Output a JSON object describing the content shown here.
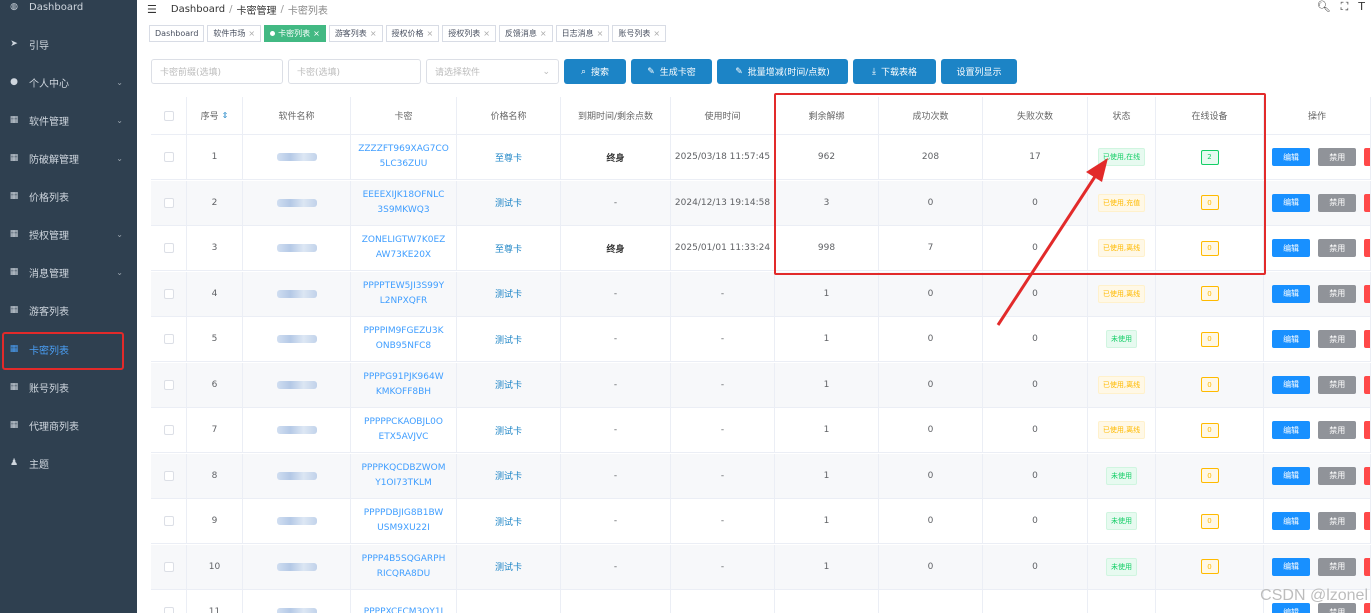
{
  "sidebar": {
    "items": [
      {
        "label": "Dashboard",
        "icon": "dashboard-icon",
        "glyph": "◍",
        "arrow": false
      },
      {
        "label": "引导",
        "icon": "send-icon",
        "glyph": "➤",
        "arrow": false
      },
      {
        "label": "个人中心",
        "icon": "user-icon",
        "glyph": "●",
        "arrow": true
      },
      {
        "label": "软件管理",
        "icon": "grid-icon",
        "glyph": "▦",
        "arrow": true
      },
      {
        "label": "防破解管理",
        "icon": "grid-icon",
        "glyph": "▦",
        "arrow": true
      },
      {
        "label": "价格列表",
        "icon": "grid-icon",
        "glyph": "▦",
        "arrow": false
      },
      {
        "label": "授权管理",
        "icon": "grid-icon",
        "glyph": "▦",
        "arrow": true
      },
      {
        "label": "消息管理",
        "icon": "grid-icon",
        "glyph": "▦",
        "arrow": true
      },
      {
        "label": "游客列表",
        "icon": "grid-icon",
        "glyph": "▦",
        "arrow": false
      },
      {
        "label": "卡密列表",
        "icon": "grid-icon",
        "glyph": "▦",
        "arrow": false,
        "active": true
      },
      {
        "label": "账号列表",
        "icon": "grid-icon",
        "glyph": "▦",
        "arrow": false
      },
      {
        "label": "代理商列表",
        "icon": "grid-icon",
        "glyph": "▦",
        "arrow": false
      },
      {
        "label": "主题",
        "icon": "shirt-icon",
        "glyph": "♟",
        "arrow": false
      }
    ]
  },
  "topbar": {
    "breadcrumb": [
      "Dashboard",
      "卡密管理",
      "卡密列表"
    ],
    "sep": "/",
    "icons": [
      "search-icon",
      "fullscreen-icon",
      "font-size-icon"
    ]
  },
  "tags": [
    {
      "label": "Dashboard",
      "closable": false
    },
    {
      "label": "软件市场",
      "closable": true
    },
    {
      "label": "卡密列表",
      "closable": true,
      "active": true
    },
    {
      "label": "游客列表",
      "closable": true
    },
    {
      "label": "授权价格",
      "closable": true
    },
    {
      "label": "授权列表",
      "closable": true
    },
    {
      "label": "反馈消息",
      "closable": true
    },
    {
      "label": "日志消息",
      "closable": true
    },
    {
      "label": "账号列表",
      "closable": true
    }
  ],
  "filters": {
    "prefix_placeholder": "卡密前缀(选填)",
    "card_placeholder": "卡密(选填)",
    "software_placeholder": "请选择软件",
    "buttons": {
      "search": "搜索",
      "generate": "生成卡密",
      "batch": "批量增减(时间/点数)",
      "download": "下载表格",
      "columns": "设置列显示"
    }
  },
  "table": {
    "headers": [
      "",
      "序号",
      "软件名称",
      "卡密",
      "价格名称",
      "到期时间/剩余点数",
      "使用时间",
      "剩余解绑",
      "成功次数",
      "失败次数",
      "状态",
      "在线设备",
      "操作"
    ],
    "actions": {
      "edit": "编辑",
      "ban": "禁用"
    },
    "rows": [
      {
        "no": "1",
        "software_suffix": "",
        "card": [
          "ZZZZFT969XAG7CO",
          "5LC36ZUU"
        ],
        "price": "至尊卡",
        "expire": "终身",
        "used": "2025/03/18 11:57:45",
        "unbind": "962",
        "success": "208",
        "fail": "17",
        "status": "已使用,在线",
        "status_color": "green",
        "online": "2"
      },
      {
        "no": "2",
        "software_suffix": "",
        "card": [
          "EEEEXIJK18OFNLC",
          "3S9MKWQ3"
        ],
        "price": "测试卡",
        "expire": "-",
        "used": "2024/12/13 19:14:58",
        "unbind": "3",
        "success": "0",
        "fail": "0",
        "status": "已使用,充值",
        "status_color": "orange",
        "online": "0"
      },
      {
        "no": "3",
        "software_suffix": "",
        "card": [
          "ZONELIGTW7K0EZ",
          "AW73KE20X"
        ],
        "price": "至尊卡",
        "expire": "终身",
        "used": "2025/01/01 11:33:24",
        "unbind": "998",
        "success": "7",
        "fail": "0",
        "status": "已使用,离线",
        "status_color": "orange",
        "online": "0"
      },
      {
        "no": "4",
        "software_suffix": "",
        "card": [
          "PPPPTEW5JI3S99Y",
          "L2NPXQFR"
        ],
        "price": "测试卡",
        "expire": "-",
        "used": "-",
        "unbind": "1",
        "success": "0",
        "fail": "0",
        "status": "已使用,离线",
        "status_color": "orange",
        "online": "0"
      },
      {
        "no": "5",
        "software_suffix": "",
        "card": [
          "PPPPIM9FGEZU3K",
          "ONB95NFC8"
        ],
        "price": "测试卡",
        "expire": "-",
        "used": "-",
        "unbind": "1",
        "success": "0",
        "fail": "0",
        "status": "未使用",
        "status_color": "green",
        "online": "0"
      },
      {
        "no": "6",
        "software_suffix": "",
        "card": [
          "PPPPG91PJK964W",
          "KMKOFF8BH"
        ],
        "price": "测试卡",
        "expire": "-",
        "used": "-",
        "unbind": "1",
        "success": "0",
        "fail": "0",
        "status": "已使用,离线",
        "status_color": "orange",
        "online": "0"
      },
      {
        "no": "7",
        "software_suffix": "",
        "card": [
          "PPPPPCKAOBJL0O",
          "ETX5AVJVC"
        ],
        "price": "测试卡",
        "expire": "-",
        "used": "-",
        "unbind": "1",
        "success": "0",
        "fail": "0",
        "status": "已使用,离线",
        "status_color": "orange",
        "online": "0"
      },
      {
        "no": "8",
        "software_suffix": "",
        "card": [
          "PPPPKQCDBZWOM",
          "Y1OI73TKLM"
        ],
        "price": "测试卡",
        "expire": "-",
        "used": "-",
        "unbind": "1",
        "success": "0",
        "fail": "0",
        "status": "未使用",
        "status_color": "green",
        "online": "0"
      },
      {
        "no": "9",
        "software_suffix": "",
        "card": [
          "PPPPDBJIG8B1BW",
          "USM9XU22I"
        ],
        "price": "测试卡",
        "expire": "-",
        "used": "-",
        "unbind": "1",
        "success": "0",
        "fail": "0",
        "status": "未使用",
        "status_color": "green",
        "online": "0"
      },
      {
        "no": "10",
        "software_suffix": "",
        "card": [
          "PPPP4B5SQGARPH",
          "RICQRA8DU"
        ],
        "price": "测试卡",
        "expire": "-",
        "used": "-",
        "unbind": "1",
        "success": "0",
        "fail": "0",
        "status": "未使用",
        "status_color": "green",
        "online": "0"
      },
      {
        "no": "11",
        "software_suffix": "",
        "card": [
          "PPPPXCFCM3QY1J",
          ""
        ],
        "price": "",
        "expire": "",
        "used": "",
        "unbind": "",
        "success": "",
        "fail": "",
        "status": "",
        "status_color": "orange",
        "online": ""
      }
    ]
  },
  "watermark": "CSDN @lzonel",
  "colors": {
    "sidebar_bg": "#2f4050",
    "primary": "#1c84c6",
    "active_tag": "#42b983",
    "annotation": "#e22a2a"
  }
}
